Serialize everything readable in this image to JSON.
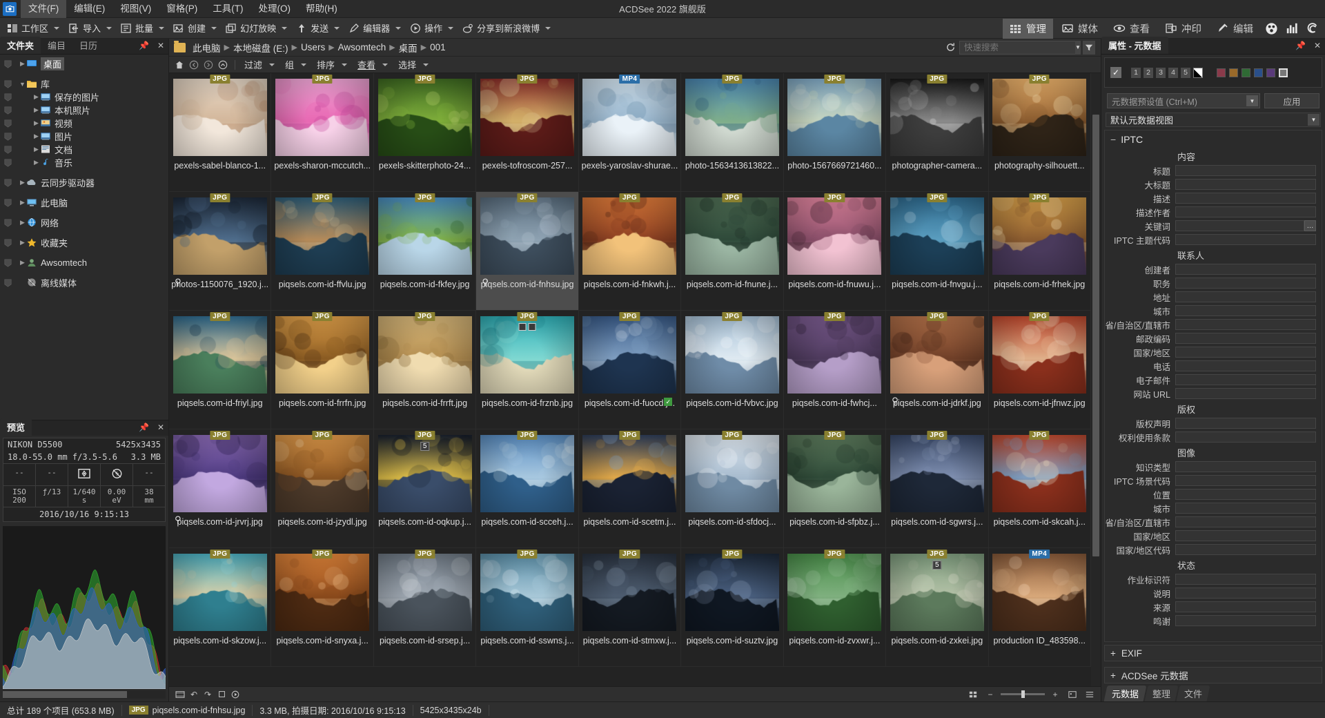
{
  "window": {
    "title": "ACDSee 2022 旗舰版"
  },
  "menu": {
    "items": [
      "文件(F)",
      "编辑(E)",
      "视图(V)",
      "窗格(P)",
      "工具(T)",
      "处理(O)",
      "帮助(H)"
    ]
  },
  "toolbar": {
    "items": [
      "工作区",
      "导入",
      "批量",
      "创建",
      "幻灯放映",
      "发送",
      "编辑器",
      "操作",
      "分享到新浪微博"
    ],
    "modes": [
      {
        "label": "管理",
        "icon": "grid-icon",
        "selected": true
      },
      {
        "label": "媒体",
        "icon": "media-icon",
        "selected": false
      },
      {
        "label": "查看",
        "icon": "eye-icon",
        "selected": false
      },
      {
        "label": "冲印",
        "icon": "print-icon",
        "selected": false
      },
      {
        "label": "编辑",
        "icon": "edit-icon",
        "selected": false
      }
    ],
    "extra_icons": [
      "people-icon",
      "chart-icon",
      "spiral-icon"
    ]
  },
  "left_panel": {
    "tabs": [
      "文件夹",
      "编目",
      "日历"
    ],
    "selected_tab": "文件夹",
    "tree": [
      {
        "label": "桌面",
        "icon": "desktop-icon",
        "indent": 1,
        "expander": "right",
        "selected": true
      },
      {
        "label": "库",
        "icon": "library-folder-icon",
        "indent": 1,
        "expander": "down",
        "selected": false
      },
      {
        "label": "保存的图片",
        "icon": "picture-icon",
        "indent": 2,
        "expander": "right",
        "selected": false
      },
      {
        "label": "本机照片",
        "icon": "picture-icon",
        "indent": 2,
        "expander": "right",
        "selected": false
      },
      {
        "label": "视频",
        "icon": "video-icon",
        "indent": 2,
        "expander": "right",
        "selected": false
      },
      {
        "label": "图片",
        "icon": "picture-icon",
        "indent": 2,
        "expander": "right",
        "selected": false
      },
      {
        "label": "文档",
        "icon": "document-icon",
        "indent": 2,
        "expander": "right",
        "selected": false
      },
      {
        "label": "音乐",
        "icon": "music-icon",
        "indent": 2,
        "expander": "right",
        "selected": false
      },
      {
        "label": "云同步驱动器",
        "icon": "cloud-icon",
        "indent": 1,
        "expander": "right",
        "selected": false
      },
      {
        "label": "此电脑",
        "icon": "computer-icon",
        "indent": 1,
        "expander": "right",
        "selected": false
      },
      {
        "label": "网络",
        "icon": "network-icon",
        "indent": 1,
        "expander": "right",
        "selected": false
      },
      {
        "label": "收藏夹",
        "icon": "star-icon",
        "indent": 1,
        "expander": "right",
        "selected": false
      },
      {
        "label": "Awsomtech",
        "icon": "user-icon",
        "indent": 1,
        "expander": "right",
        "selected": false
      },
      {
        "label": "离线媒体",
        "icon": "offline-media-icon",
        "indent": 1,
        "expander": "none",
        "selected": false
      }
    ]
  },
  "preview_panel": {
    "tab": "预览",
    "camera": "NIKON D5500",
    "dimensions": "5425x3435",
    "lens": "18.0-55.0 mm  f/3.5-5.6",
    "filesize": "3.3 MB",
    "icon_row": [
      "--",
      "--",
      "metering-icon",
      "flash-off-icon",
      "--"
    ],
    "exif_row": [
      "ISO 200",
      "ƒ/13",
      "1/640 s",
      "0.00 eV",
      "38 mm"
    ],
    "exif_row_parts": [
      {
        "a": "ISO",
        "b": "200"
      },
      {
        "a": "ƒ/13",
        "b": ""
      },
      {
        "a": "1/640",
        "b": "s"
      },
      {
        "a": "0.00",
        "b": "eV"
      },
      {
        "a": "38",
        "b": "mm"
      }
    ],
    "datetime": "2016/10/16 9:15:13"
  },
  "breadcrumb": {
    "items": [
      "此电脑",
      "本地磁盘 (E:)",
      "Users",
      "Awsomtech",
      "桌面",
      "001"
    ],
    "refresh_icon": "refresh-icon",
    "search_placeholder": "快速搜索",
    "filter_icon": "filter-icon"
  },
  "filterbar": {
    "nav_icons": [
      "home-icon",
      "back-icon",
      "forward-icon",
      "up-icon"
    ],
    "items": [
      "过滤",
      "组",
      "排序",
      "查看",
      "选择"
    ],
    "underlined": "查看"
  },
  "thumbnails": [
    {
      "name": "pexels-sabel-blanco-1...",
      "type": "JPG",
      "theme": "cake"
    },
    {
      "name": "pexels-sharon-mccutch...",
      "type": "JPG",
      "theme": "sprinkles"
    },
    {
      "name": "pexels-skitterphoto-24...",
      "type": "JPG",
      "theme": "forest"
    },
    {
      "name": "pexels-tofroscom-257...",
      "type": "JPG",
      "theme": "gifts"
    },
    {
      "name": "pexels-yaroslav-shurae...",
      "type": "MP4",
      "theme": "snow"
    },
    {
      "name": "photo-1563413613822...",
      "type": "JPG",
      "theme": "river-city"
    },
    {
      "name": "photo-1567669721460...",
      "type": "JPG",
      "theme": "aerial-city"
    },
    {
      "name": "photographer-camera...",
      "type": "JPG",
      "theme": "bw-crew"
    },
    {
      "name": "photography-silhouett...",
      "type": "JPG",
      "theme": "silhouette"
    },
    {
      "name": "photos-1150076_1920.j...",
      "type": "JPG",
      "theme": "street-night",
      "marker": "pin"
    },
    {
      "name": "piqsels.com-id-ffvlu.jpg",
      "type": "JPG",
      "theme": "venice"
    },
    {
      "name": "piqsels.com-id-fkfey.jpg",
      "type": "JPG",
      "theme": "windmill"
    },
    {
      "name": "piqsels.com-id-fnhsu.jpg",
      "type": "JPG",
      "theme": "lake-fog",
      "selected": true,
      "marker": "pin"
    },
    {
      "name": "piqsels.com-id-fnkwh.j...",
      "type": "JPG",
      "theme": "sunset-city"
    },
    {
      "name": "piqsels.com-id-fnune.j...",
      "type": "JPG",
      "theme": "mountain-lake"
    },
    {
      "name": "piqsels.com-id-fnuwu.j...",
      "type": "JPG",
      "theme": "pink-sky"
    },
    {
      "name": "piqsels.com-id-fnvgu.j...",
      "type": "JPG",
      "theme": "blue-sea"
    },
    {
      "name": "piqsels.com-id-frhek.jpg",
      "type": "JPG",
      "theme": "prague"
    },
    {
      "name": "piqsels.com-id-friyl.jpg",
      "type": "JPG",
      "theme": "cliff-town"
    },
    {
      "name": "piqsels.com-id-frrfn.jpg",
      "type": "JPG",
      "theme": "ship-sunset"
    },
    {
      "name": "piqsels.com-id-frrft.jpg",
      "type": "JPG",
      "theme": "desert"
    },
    {
      "name": "piqsels.com-id-frznb.jpg",
      "type": "JPG",
      "theme": "turquoise-beach",
      "marker": "marks"
    },
    {
      "name": "piqsels.com-id-fuocd.j...",
      "type": "JPG",
      "theme": "blue-mountain",
      "marker": "check"
    },
    {
      "name": "piqsels.com-id-fvbvc.jpg",
      "type": "JPG",
      "theme": "snow-field"
    },
    {
      "name": "piqsels.com-id-fwhcj...",
      "type": "JPG",
      "theme": "purple-coast"
    },
    {
      "name": "piqsels.com-id-jdrkf.jpg",
      "type": "JPG",
      "theme": "canyon-city",
      "marker": "pin"
    },
    {
      "name": "piqsels.com-id-jfnwz.jpg",
      "type": "JPG",
      "theme": "golden-gate"
    },
    {
      "name": "piqsels.com-id-jrvrj.jpg",
      "type": "JPG",
      "theme": "boat-purple",
      "marker": "pin"
    },
    {
      "name": "piqsels.com-id-jzydl.jpg",
      "type": "JPG",
      "theme": "coast-sunset"
    },
    {
      "name": "piqsels.com-id-oqkup.j...",
      "type": "JPG",
      "theme": "night-city",
      "marker": "count",
      "count": "5"
    },
    {
      "name": "piqsels.com-id-scceh.j...",
      "type": "JPG",
      "theme": "skyline-blue"
    },
    {
      "name": "piqsels.com-id-scetm.j...",
      "type": "JPG",
      "theme": "hk-night"
    },
    {
      "name": "piqsels.com-id-sfdocj...",
      "type": "JPG",
      "theme": "snow-village"
    },
    {
      "name": "piqsels.com-id-sfpbz.j...",
      "type": "JPG",
      "theme": "pine-mist"
    },
    {
      "name": "piqsels.com-id-sgwrs.j...",
      "type": "JPG",
      "theme": "dusk-lake"
    },
    {
      "name": "piqsels.com-id-skcah.j...",
      "type": "JPG",
      "theme": "golden-gate-2"
    },
    {
      "name": "piqsels.com-id-skzow.j...",
      "type": "JPG",
      "theme": "beach-bay"
    },
    {
      "name": "piqsels.com-id-snyxa.j...",
      "type": "JPG",
      "theme": "paris-sunset"
    },
    {
      "name": "piqsels.com-id-srsep.j...",
      "type": "JPG",
      "theme": "grey-mountain"
    },
    {
      "name": "piqsels.com-id-sswns.j...",
      "type": "JPG",
      "theme": "calm-sea"
    },
    {
      "name": "piqsels.com-id-stmxw.j...",
      "type": "JPG",
      "theme": "dark-peak"
    },
    {
      "name": "piqsels.com-id-suztv.jpg",
      "type": "JPG",
      "theme": "night-mountain"
    },
    {
      "name": "piqsels.com-id-zvxwr.j...",
      "type": "JPG",
      "theme": "aerial-green"
    },
    {
      "name": "piqsels.com-id-zxkei.jpg",
      "type": "JPG",
      "theme": "aerial-town",
      "marker": "count",
      "count": "5"
    },
    {
      "name": "production ID_483598...",
      "type": "MP4",
      "theme": "film-strip"
    }
  ],
  "bottom_toolbar": {
    "icons": [
      "filmstrip-icon",
      "undo-icon",
      "redo-icon",
      "stop-icon",
      "play-icon"
    ],
    "zoom_icons": [
      "zoom-out-icon",
      "zoom-in-icon",
      "thumb-view-icon",
      "detail-view-icon"
    ]
  },
  "right_panel": {
    "title": "属性 - 元数据",
    "pin_icon": "pin-icon",
    "close_icon": "close-icon",
    "ratings": [
      "1",
      "2",
      "3",
      "4",
      "5"
    ],
    "color_labels": [
      "#8a3a4a",
      "#9a6a2a",
      "#2f6a34",
      "#2a4f8a",
      "#5a3a7a",
      "#777777"
    ],
    "preset_placeholder": "元数据预设值 (Ctrl+M)",
    "apply_label": "应用",
    "view_selected": "默认元数据视图",
    "sections": [
      {
        "name": "IPTC",
        "expanded": true,
        "groups": [
          {
            "title": "内容",
            "fields": [
              "标题",
              "大标题",
              "描述",
              "描述作者",
              "关键词",
              "IPTC 主题代码"
            ]
          },
          {
            "title": "联系人",
            "fields": [
              "创建者",
              "职务",
              "地址",
              "城市",
              "省/自治区/直辖市",
              "邮政编码",
              "国家/地区",
              "电话",
              "电子邮件",
              "网站 URL"
            ]
          },
          {
            "title": "版权",
            "fields": [
              "版权声明",
              "权利使用条款"
            ]
          },
          {
            "title": "图像",
            "fields": [
              "知识类型",
              "IPTC 场景代码",
              "位置",
              "城市",
              "省/自治区/直辖市",
              "国家/地区",
              "国家/地区代码"
            ]
          },
          {
            "title": "状态",
            "fields": [
              "作业标识符",
              "说明",
              "来源",
              "鸣谢"
            ]
          }
        ]
      }
    ],
    "collapsed_sections": [
      "EXIF",
      "ACDSee 元数据"
    ],
    "tabs": [
      "元数据",
      "整理",
      "文件"
    ],
    "selected_tab": "元数据",
    "dots_field": "关键词"
  },
  "status_bar": {
    "total": "总计 189 个项目 (653.8 MB)",
    "file_type": "JPG",
    "filename": "piqsels.com-id-fnhsu.jpg",
    "details": "3.3 MB, 拍摄日期: 2016/10/16 9:15:13",
    "dimensions": "5425x3435x24b"
  }
}
